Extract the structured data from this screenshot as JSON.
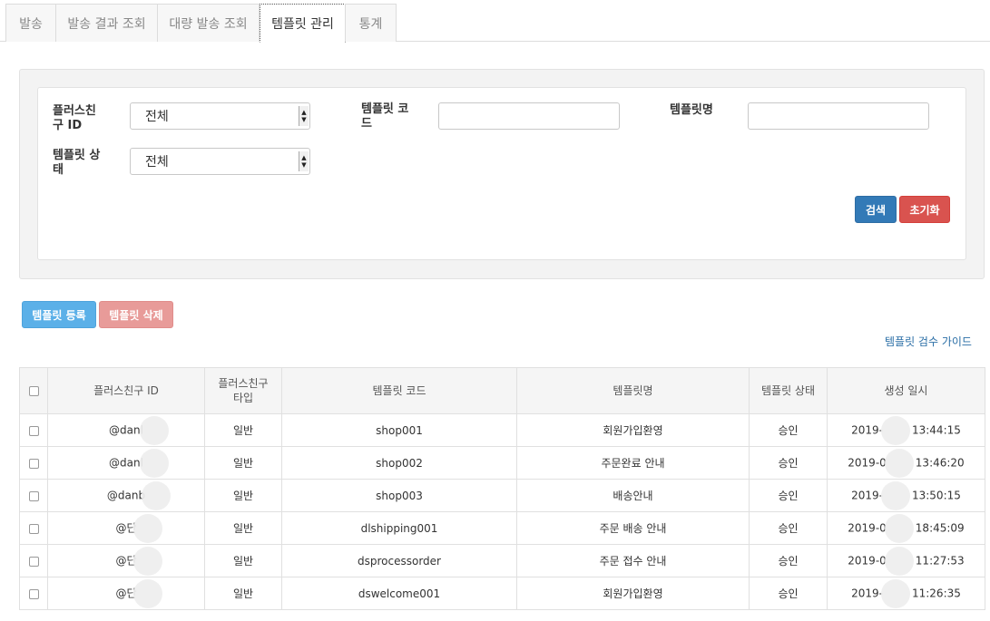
{
  "tabs": [
    {
      "label": "발송",
      "active": false
    },
    {
      "label": "발송 결과 조회",
      "active": false
    },
    {
      "label": "대량 발송 조회",
      "active": false
    },
    {
      "label": "템플릿 관리",
      "active": true
    },
    {
      "label": "통계",
      "active": false
    }
  ],
  "filters": {
    "plusfriend_label": "플러스친\n구 ID",
    "plusfriend_value": "전체",
    "template_code_label": "템플릿 코\n드",
    "template_code_value": "",
    "template_name_label": "템플릿명",
    "template_name_value": "",
    "template_status_label": "템플릿 상\n태",
    "template_status_value": "전체",
    "search_label": "검색",
    "reset_label": "초기화"
  },
  "actions": {
    "register_label": "템플릿 등록",
    "delete_label": "템플릿 삭제",
    "guide_label": "템플릿 검수 가이드"
  },
  "table": {
    "headers": [
      "플러스친구 ID",
      "플러스친구\n타입",
      "템플릿 코드",
      "템플릿명",
      "템플릿 상태",
      "생성 일시"
    ],
    "rows": [
      {
        "id": "@danl",
        "type": "일반",
        "code": "shop001",
        "name": "회원가입환영",
        "status": "승인",
        "date": "2019-",
        "time": "13:44:15"
      },
      {
        "id": "@danl",
        "type": "일반",
        "code": "shop002",
        "name": "주문완료 안내",
        "status": "승인",
        "date": "2019-0",
        "time": "13:46:20"
      },
      {
        "id": "@danb",
        "type": "일반",
        "code": "shop003",
        "name": "배송안내",
        "status": "승인",
        "date": "2019-",
        "time": "13:50:15"
      },
      {
        "id": "@단",
        "type": "일반",
        "code": "dlshipping001",
        "name": "주문 배송 안내",
        "status": "승인",
        "date": "2019-0",
        "time": "18:45:09"
      },
      {
        "id": "@단",
        "type": "일반",
        "code": "dsprocessorder",
        "name": "주문 접수 안내",
        "status": "승인",
        "date": "2019-0",
        "time": "11:27:53"
      },
      {
        "id": "@단",
        "type": "일반",
        "code": "dswelcome001",
        "name": "회원가입환영",
        "status": "승인",
        "date": "2019-",
        "time": "11:26:35"
      }
    ]
  }
}
